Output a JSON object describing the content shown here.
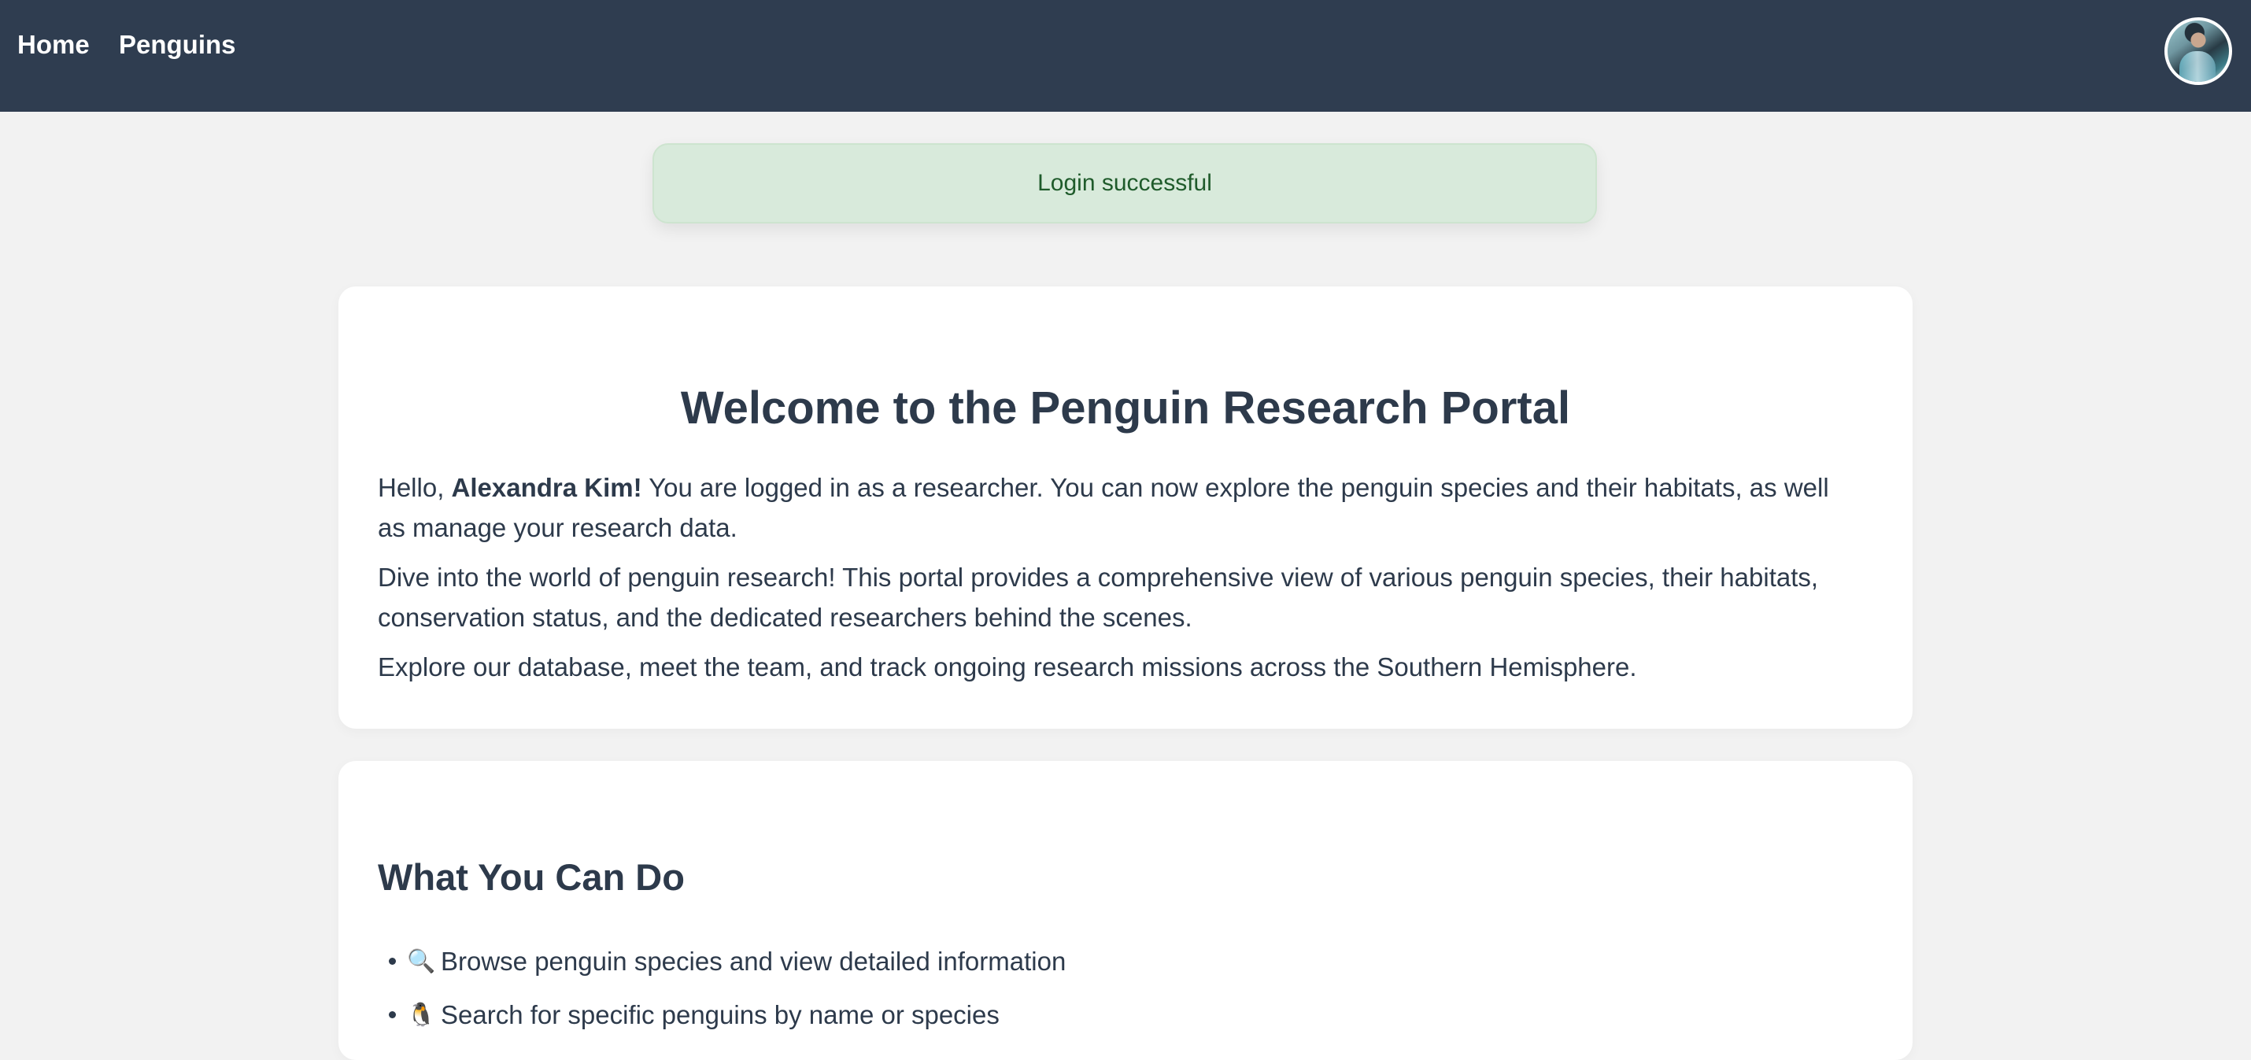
{
  "navigation": {
    "items": [
      {
        "label": "Home"
      },
      {
        "label": "Penguins"
      }
    ],
    "avatar_icon": "user-avatar-icon"
  },
  "alert": {
    "message": "Login successful"
  },
  "welcome": {
    "title": "Welcome to the Penguin Research Portal",
    "greeting_prefix": "Hello, ",
    "user_name": "Alexandra Kim!",
    "greeting_suffix": " You are logged in as a researcher. You can now explore the penguin species and their habitats, as well as manage your research data.",
    "paragraph_2": "Dive into the world of penguin research! This portal provides a comprehensive view of various penguin species, their habitats, conservation status, and the dedicated researchers behind the scenes.",
    "paragraph_3": "Explore our database, meet the team, and track ongoing research missions across the Southern Hemisphere."
  },
  "actions": {
    "title": "What You Can Do",
    "items": [
      {
        "icon": "🔍",
        "icon_name": "magnifying-glass-icon",
        "label": "Browse penguin species and view detailed information"
      },
      {
        "icon": "🐧",
        "icon_name": "penguin-icon",
        "label": "Search for specific penguins by name or species"
      }
    ]
  },
  "colors": {
    "header_background": "#2f3d50",
    "page_background": "#f2f2f2",
    "text": "#2d3a4b",
    "success_background": "#d8eadb",
    "success_text": "#1f5b2b"
  }
}
